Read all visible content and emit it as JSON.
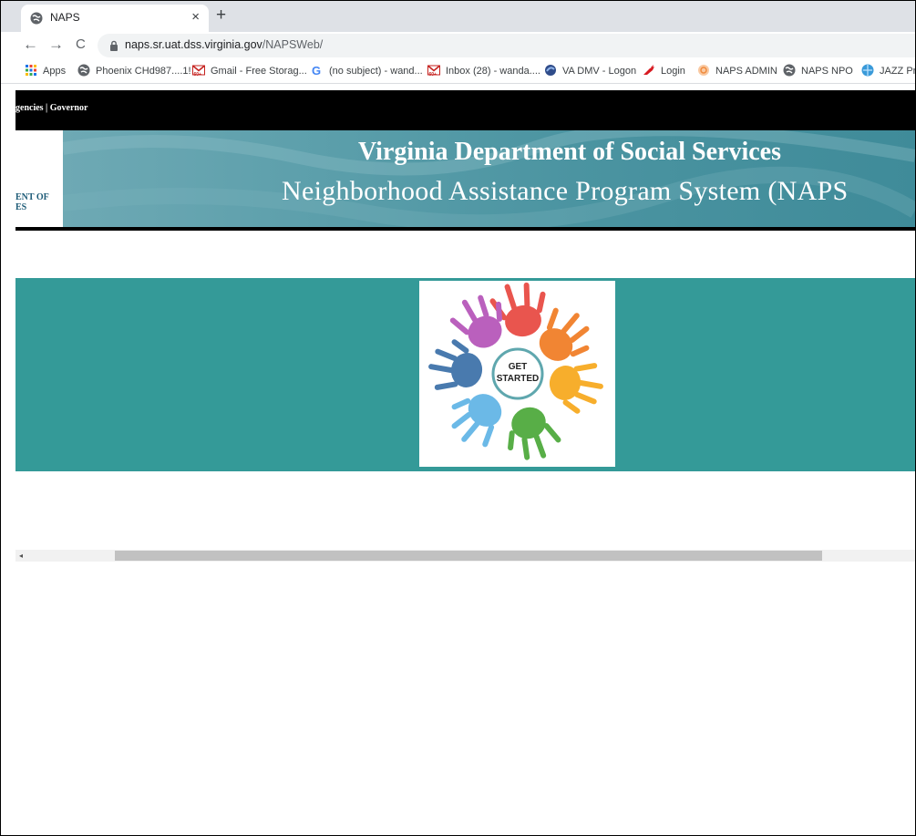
{
  "browser": {
    "tab_title": "NAPS",
    "tab_close": "×",
    "new_tab": "+",
    "url_host": "naps.sr.uat.dss.virginia.gov",
    "url_path": "/NAPSWeb/",
    "nav_back": "←",
    "nav_forward": "→",
    "nav_reload": "C"
  },
  "bookmarks": [
    {
      "label": "Apps",
      "icon": "apps-grid-icon"
    },
    {
      "label": "Phoenix CHd987....1!",
      "icon": "globe-icon"
    },
    {
      "label": "Gmail - Free Storag...",
      "icon": "gmail-icon"
    },
    {
      "label": "(no subject) - wand...",
      "icon": "google-icon"
    },
    {
      "label": "Inbox (28) - wanda....",
      "icon": "gmail-icon"
    },
    {
      "label": "VA DMV - Logon",
      "icon": "dmv-icon"
    },
    {
      "label": "Login",
      "icon": "cardinal-icon"
    },
    {
      "label": "NAPS ADMIN",
      "icon": "naps-admin-icon"
    },
    {
      "label": "NAPS NPO",
      "icon": "globe-icon"
    },
    {
      "label": "JAZZ Pr",
      "icon": "jazz-icon"
    }
  ],
  "page": {
    "gov_bar_text": "gencies | Governor",
    "banner_left_line1": "ENT OF",
    "banner_left_line2": "ES",
    "banner_title": "Virginia Department of Social Services",
    "banner_subtitle": "Neighborhood Assistance Program System (NAPS",
    "get_started_line1": "GET",
    "get_started_line2": "STARTED"
  },
  "colors": {
    "teal_section": "#349a98",
    "gov_bar": "#000000",
    "banner": "#4f9aa6"
  },
  "scrollbar": {
    "arrow": "◂"
  }
}
